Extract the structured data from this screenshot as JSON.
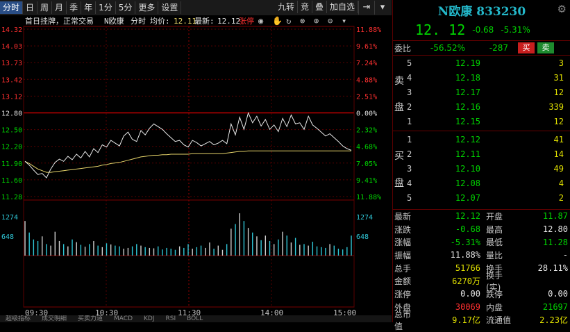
{
  "toolbar": {
    "periods": [
      "分时",
      "日",
      "周",
      "月",
      "季",
      "年",
      "1分",
      "5分",
      "更多",
      "设置"
    ],
    "right": [
      "九转",
      "竞",
      "叠",
      "加自选"
    ]
  },
  "chart": {
    "info": {
      "status": "首日挂牌，正常交易",
      "name": "N欧康",
      "mode": "分时",
      "avg_label": "均价:",
      "avg": "12.11",
      "last_label": "最新:",
      "last": "12.12",
      "limit": "张停"
    },
    "price_ticks": [
      "14.32",
      "14.03",
      "13.73",
      "13.42",
      "13.12",
      "12.80",
      "12.50",
      "12.20",
      "11.90",
      "11.60",
      "11.28"
    ],
    "pct_ticks": [
      "11.88%",
      "9.61%",
      "7.24%",
      "4.88%",
      "2.51%",
      "0.00%",
      "2.32%",
      "4.68%",
      "7.05%",
      "9.41%",
      "11.88%"
    ],
    "vol_ticks": [
      "1274",
      "648"
    ],
    "time_ticks": [
      "09:30",
      "10:30",
      "11:30",
      "14:00",
      "15:00"
    ]
  },
  "chart_data": {
    "type": "line",
    "prev_close": 12.8,
    "ylim": [
      11.28,
      14.32
    ],
    "x": [
      "09:30",
      "10:30",
      "11:30",
      "14:00",
      "15:00"
    ],
    "series": [
      {
        "values": [
          11.92,
          11.85,
          11.76,
          11.68,
          11.7,
          11.62,
          11.78,
          11.9,
          11.96,
          11.92,
          12.01,
          11.95,
          12.05,
          11.98,
          12.1,
          12.0,
          12.15,
          12.08,
          12.22,
          12.18,
          12.3,
          12.25,
          12.2,
          12.38,
          12.45,
          12.32,
          12.28,
          12.48,
          12.4,
          12.52,
          12.6,
          12.55,
          12.5,
          12.42,
          12.35,
          12.28,
          12.3,
          12.22,
          12.18,
          12.3,
          12.26,
          12.2,
          12.24,
          12.28,
          12.22,
          12.25,
          12.3,
          12.24,
          12.6,
          12.4,
          12.72,
          12.5,
          12.8,
          12.62,
          12.74,
          12.56,
          12.68,
          12.5,
          12.58,
          12.46,
          12.7,
          12.55,
          12.76,
          12.6,
          12.62,
          12.5,
          12.74,
          12.58,
          12.52,
          12.45,
          12.38,
          12.42,
          12.35,
          12.28,
          12.2,
          12.15,
          12.12
        ]
      },
      {
        "values": [
          11.92,
          11.88,
          11.83,
          11.78,
          11.75,
          11.72,
          11.72,
          11.73,
          11.74,
          11.75,
          11.76,
          11.77,
          11.78,
          11.79,
          11.8,
          11.81,
          11.82,
          11.83,
          11.85,
          11.86,
          11.88,
          11.89,
          11.9,
          11.92,
          11.94,
          11.96,
          11.98,
          12.0,
          12.01,
          12.02,
          12.03,
          12.03,
          12.04,
          12.04,
          12.05,
          12.05,
          12.05,
          12.05,
          12.05,
          12.06,
          12.06,
          12.06,
          12.06,
          12.06,
          12.06,
          12.06,
          12.06,
          12.07,
          12.08,
          12.09,
          12.1,
          12.1,
          12.11,
          12.11,
          12.11,
          12.11,
          12.11,
          12.11,
          12.11,
          12.11,
          12.11,
          12.11,
          12.11,
          12.11,
          12.11,
          12.11,
          12.11,
          12.11,
          12.11,
          12.11,
          12.11,
          12.11,
          12.11,
          12.11,
          12.11,
          12.11,
          12.11
        ]
      }
    ],
    "volume": [
      900,
      600,
      420,
      380,
      500,
      300,
      260,
      620,
      380,
      300,
      240,
      420,
      350,
      280,
      230,
      300,
      380,
      260,
      220,
      320,
      290,
      260,
      240,
      180,
      200,
      240,
      300,
      260,
      220,
      200,
      190,
      240,
      160,
      200,
      180,
      150,
      240,
      200,
      300,
      180,
      220,
      260,
      200,
      340,
      180,
      260,
      150,
      300,
      700,
      820,
      1100,
      900,
      720,
      600,
      500,
      400,
      520,
      380,
      300,
      420,
      620,
      520,
      340,
      460,
      280,
      300,
      260,
      360,
      240,
      220,
      200,
      300,
      260,
      180,
      160,
      220,
      520
    ]
  },
  "panel": {
    "code_name": "N欧康 833230",
    "price": "12. 12",
    "change": "-0.68",
    "change_pct": "-5.31%",
    "weibi_label": "委比",
    "weibi": "-56.52%",
    "weicha": "-287",
    "sell_btn": "买",
    "buy_btn": "卖",
    "sell_label_1": "卖",
    "sell_label_2": "盘",
    "buy_label_1": "买",
    "buy_label_2": "盘",
    "asks": [
      {
        "lvl": "5",
        "price": "12.19",
        "vol": "3"
      },
      {
        "lvl": "4",
        "price": "12.18",
        "vol": "31"
      },
      {
        "lvl": "3",
        "price": "12.17",
        "vol": "12"
      },
      {
        "lvl": "2",
        "price": "12.16",
        "vol": "339"
      },
      {
        "lvl": "1",
        "price": "12.15",
        "vol": "12"
      }
    ],
    "bids": [
      {
        "lvl": "1",
        "price": "12.12",
        "vol": "41"
      },
      {
        "lvl": "2",
        "price": "12.11",
        "vol": "14"
      },
      {
        "lvl": "3",
        "price": "12.10",
        "vol": "49"
      },
      {
        "lvl": "4",
        "price": "12.08",
        "vol": "4"
      },
      {
        "lvl": "5",
        "price": "12.07",
        "vol": "2"
      }
    ],
    "stats": [
      {
        "k": "最新",
        "v": "12.12",
        "vc": "c-green",
        "k2": "开盘",
        "v2": "11.87",
        "v2c": "c-green"
      },
      {
        "k": "涨跌",
        "v": "-0.68",
        "vc": "c-green",
        "k2": "最高",
        "v2": "12.80",
        "v2c": "c-white"
      },
      {
        "k": "涨幅",
        "v": "-5.31%",
        "vc": "c-green",
        "k2": "最低",
        "v2": "11.28",
        "v2c": "c-green"
      },
      {
        "k": "振幅",
        "v": "11.88%",
        "vc": "c-white",
        "k2": "量比",
        "v2": "-",
        "v2c": "c-white"
      },
      {
        "k": "总手",
        "v": "51766",
        "vc": "c-yellow",
        "k2": "换手",
        "v2": "28.11%",
        "v2c": "c-white"
      },
      {
        "k": "金额",
        "v": "6270万",
        "vc": "c-yellow",
        "k2": "换手(实)",
        "v2": "",
        "v2c": "c-white"
      },
      {
        "k": "涨停",
        "v": "0.00",
        "vc": "c-white",
        "k2": "跌停",
        "v2": "0.00",
        "v2c": "c-white"
      },
      {
        "k": "外盘",
        "v": "30069",
        "vc": "c-red",
        "k2": "内盘",
        "v2": "21697",
        "v2c": "c-green"
      },
      {
        "k": "总市值",
        "v": "9.17亿",
        "vc": "c-yellow",
        "k2": "流通值",
        "v2": "2.23亿",
        "v2c": "c-yellow"
      }
    ]
  },
  "bottom_tabs": [
    "超级指标",
    "成交明细",
    "买卖力道",
    "MACD",
    "KDJ",
    "RSI",
    "BOLL"
  ]
}
